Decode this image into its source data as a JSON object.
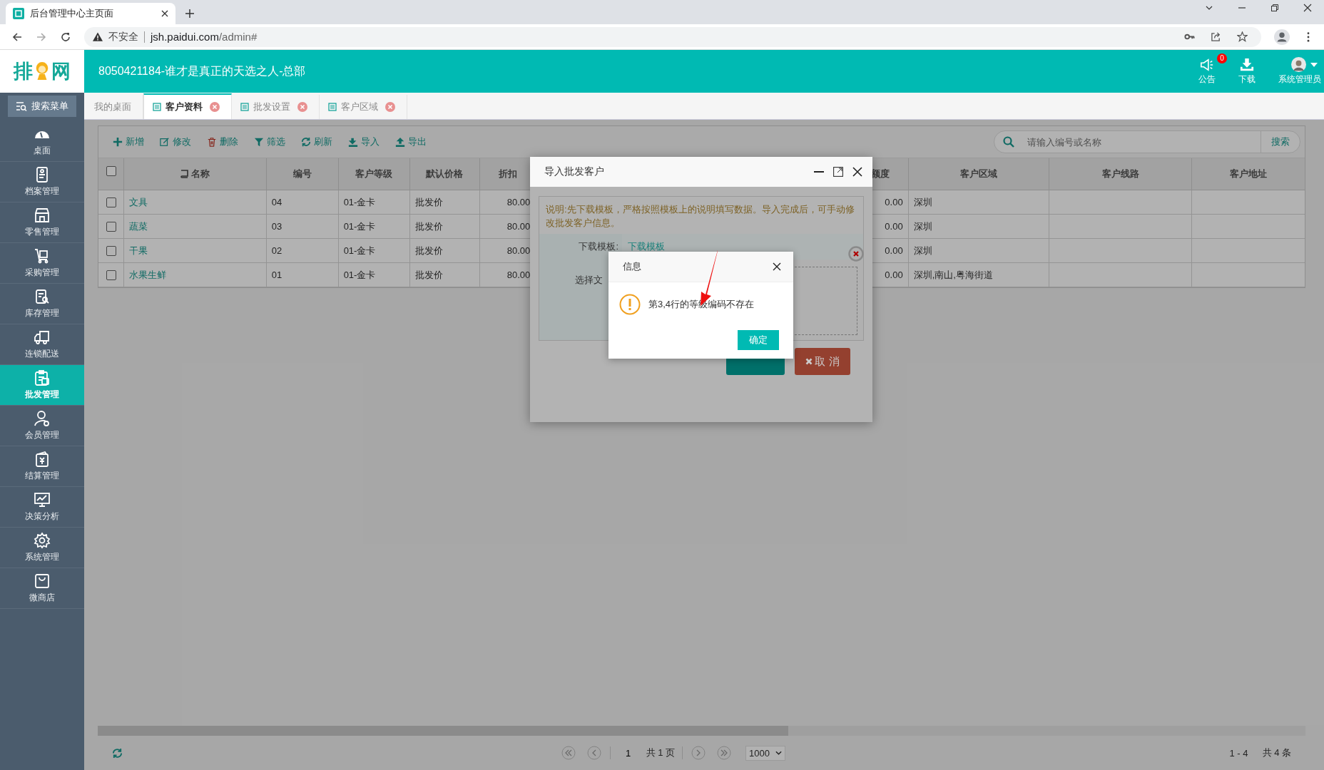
{
  "browser": {
    "tab_title": "后台管理中心主页面",
    "security": "不安全",
    "url_host": "jsh.paidui.com",
    "url_path": "/admin#"
  },
  "header": {
    "logo_left": "排",
    "logo_right": "网",
    "title": "8050421184-谁才是真正的天选之人-总部",
    "actions": [
      {
        "kind": "notice",
        "label": "公告",
        "badge": "0"
      },
      {
        "kind": "download",
        "label": "下载"
      },
      {
        "kind": "user",
        "label": "系统管理员"
      }
    ]
  },
  "sidebar": {
    "search": "搜索菜单",
    "items": [
      {
        "kind": "gauge",
        "label": "桌面",
        "selected": false
      },
      {
        "kind": "file",
        "label": "档案管理",
        "selected": false
      },
      {
        "kind": "store",
        "label": "零售管理",
        "selected": false
      },
      {
        "kind": "cart",
        "label": "采购管理",
        "selected": false
      },
      {
        "kind": "stock",
        "label": "库存管理",
        "selected": false
      },
      {
        "kind": "truck",
        "label": "连锁配送",
        "selected": false
      },
      {
        "kind": "clipboard",
        "label": "批发管理",
        "selected": true
      },
      {
        "kind": "member",
        "label": "会员管理",
        "selected": false
      },
      {
        "kind": "money",
        "label": "结算管理",
        "selected": false
      },
      {
        "kind": "chart",
        "label": "决策分析",
        "selected": false
      },
      {
        "kind": "gear",
        "label": "系统管理",
        "selected": false
      },
      {
        "kind": "bag",
        "label": "微商店",
        "selected": false
      }
    ]
  },
  "tabs": [
    {
      "label": "我的桌面",
      "selected": false,
      "closable": false
    },
    {
      "label": "客户资料",
      "selected": true,
      "closable": true
    },
    {
      "label": "批发设置",
      "selected": false,
      "closable": true
    },
    {
      "label": "客户区域",
      "selected": false,
      "closable": true
    }
  ],
  "toolbar": [
    {
      "kind": "plus",
      "label": "新增"
    },
    {
      "kind": "edit",
      "label": "修改"
    },
    {
      "kind": "trash",
      "label": "删除"
    },
    {
      "kind": "filter",
      "label": "筛选"
    },
    {
      "kind": "refresh",
      "label": "刷新"
    },
    {
      "kind": "import",
      "label": "导入"
    },
    {
      "kind": "export",
      "label": "导出"
    }
  ],
  "search": {
    "placeholder": "请输入编号或名称",
    "button": "搜索"
  },
  "table": {
    "select_all_checked": false,
    "columns": [
      "名称",
      "编号",
      "客户等级",
      "默认价格",
      "折扣",
      "额度",
      "客户区域",
      "客户线路",
      "客户地址"
    ],
    "rows": [
      {
        "checked": false,
        "cells": [
          "文具",
          "04",
          "01-金卡",
          "批发价",
          "80.00",
          "0.00",
          "深圳",
          "",
          ""
        ]
      },
      {
        "checked": false,
        "cells": [
          "蔬菜",
          "03",
          "01-金卡",
          "批发价",
          "80.00",
          "0.00",
          "深圳",
          "",
          ""
        ]
      },
      {
        "checked": false,
        "cells": [
          "干果",
          "02",
          "01-金卡",
          "批发价",
          "80.00",
          "0.00",
          "深圳",
          "",
          ""
        ]
      },
      {
        "checked": false,
        "cells": [
          "水果生鲜",
          "01",
          "01-金卡",
          "批发价",
          "80.00",
          "0.00",
          "深圳,南山,粤海街道",
          "",
          ""
        ]
      }
    ]
  },
  "pagination": {
    "page": "1",
    "total_pages": "共 1 页",
    "page_size": "1000",
    "range": "1 - 4",
    "total": "共 4 条"
  },
  "import_dialog": {
    "title": "导入批发客户",
    "notice": "说明:先下载模板，严格按照模板上的说明填写数据。导入完成后，可手动修改批发客户信息。",
    "template_label": "下载模板:",
    "template_link": "下载模板",
    "file_label": "选择文",
    "cancel": "取 消"
  },
  "message": {
    "title": "信息",
    "kind": "warning",
    "text": "第3,4行的等级编码不存在",
    "ok": "确定"
  }
}
